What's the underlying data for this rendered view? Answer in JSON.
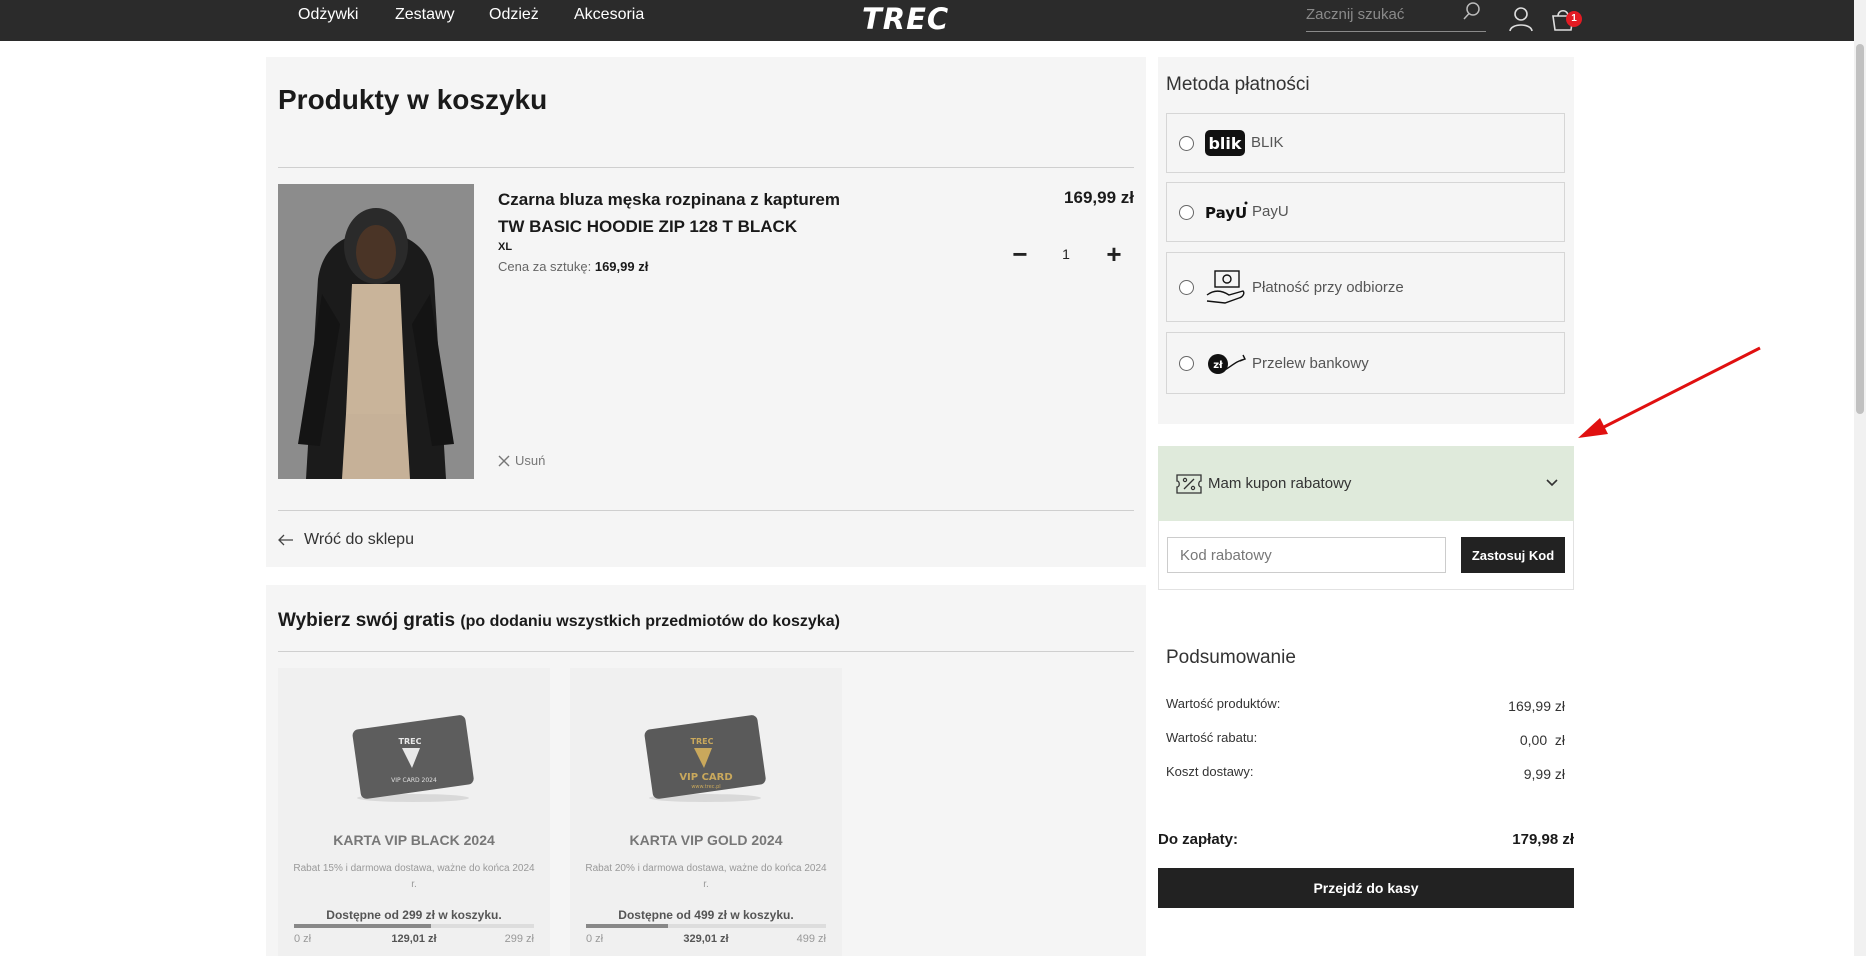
{
  "nav": {
    "items": [
      "Odżywki",
      "Zestawy",
      "Odzież",
      "Akcesoria"
    ],
    "logo": "TREC",
    "search_placeholder": "Zacznij szukać",
    "cart_count": "1"
  },
  "cart": {
    "title": "Produkty w koszyku",
    "product": {
      "name_line1": "Czarna bluza męska rozpinana z kapturem",
      "name_line2": "TW BASIC HOODIE ZIP 128 T BLACK",
      "size": "XL",
      "unit_price_label": "Cena za sztukę:",
      "unit_price": "169,99 zł",
      "price": "169,99 zł",
      "quantity": "1",
      "minus": "−",
      "plus": "+",
      "remove_label": "Usuń"
    },
    "back_label": "Wróć do sklepu"
  },
  "gifts": {
    "title": "Wybierz swój gratis",
    "subtitle": "(po dodaniu wszystkich przedmiotów do koszyka)",
    "cards": [
      {
        "name": "KARTA VIP BLACK 2024",
        "desc": "Rabat 15% i darmowa dostawa, ważne do końca 2024 r.",
        "available": "Dostępne od 299 zł w koszyku.",
        "low": "0 zł",
        "missing": "129,01 zł",
        "high": "299 zł",
        "progress": 0.57,
        "card_text": "VIP CARD 2024",
        "card_brand": "TREC"
      },
      {
        "name": "KARTA VIP GOLD 2024",
        "desc": "Rabat 20% i darmowa dostawa, ważne do końca 2024 r.",
        "available": "Dostępne od 499 zł w koszyku.",
        "low": "0 zł",
        "missing": "329,01 zł",
        "high": "499 zł",
        "progress": 0.34,
        "card_text": "VIP CARD",
        "card_brand": "TREC",
        "card_url": "www.trec.pl"
      }
    ]
  },
  "payment": {
    "title": "Metoda płatności",
    "options": [
      {
        "label": "BLIK",
        "logo": "blik"
      },
      {
        "label": "PayU",
        "logo": "PayU"
      },
      {
        "label": "Płatność przy odbiorze",
        "logo": "cash-on-delivery-icon"
      },
      {
        "label": "Przelew bankowy",
        "logo": "bank-transfer-icon"
      }
    ]
  },
  "coupon": {
    "title": "Mam kupon rabatowy",
    "placeholder": "Kod rabatowy",
    "button": "Zastosuj Kod"
  },
  "summary": {
    "title": "Podsumowanie",
    "rows": [
      {
        "label": "Wartość produktów:",
        "value": "169,99 zł"
      },
      {
        "label": "Wartość rabatu:",
        "value": "0,00  zł"
      },
      {
        "label": "Koszt dostawy:",
        "value": "9,99 zł"
      }
    ],
    "total_label": "Do zapłaty:",
    "total_value": "179,98 zł",
    "checkout": "Przejdź do kasy"
  },
  "colors": {
    "topbar": "#2b2b2b",
    "coupon_bg": "#dfeadb",
    "badge": "#e31b23",
    "arrow": "#e01010"
  }
}
